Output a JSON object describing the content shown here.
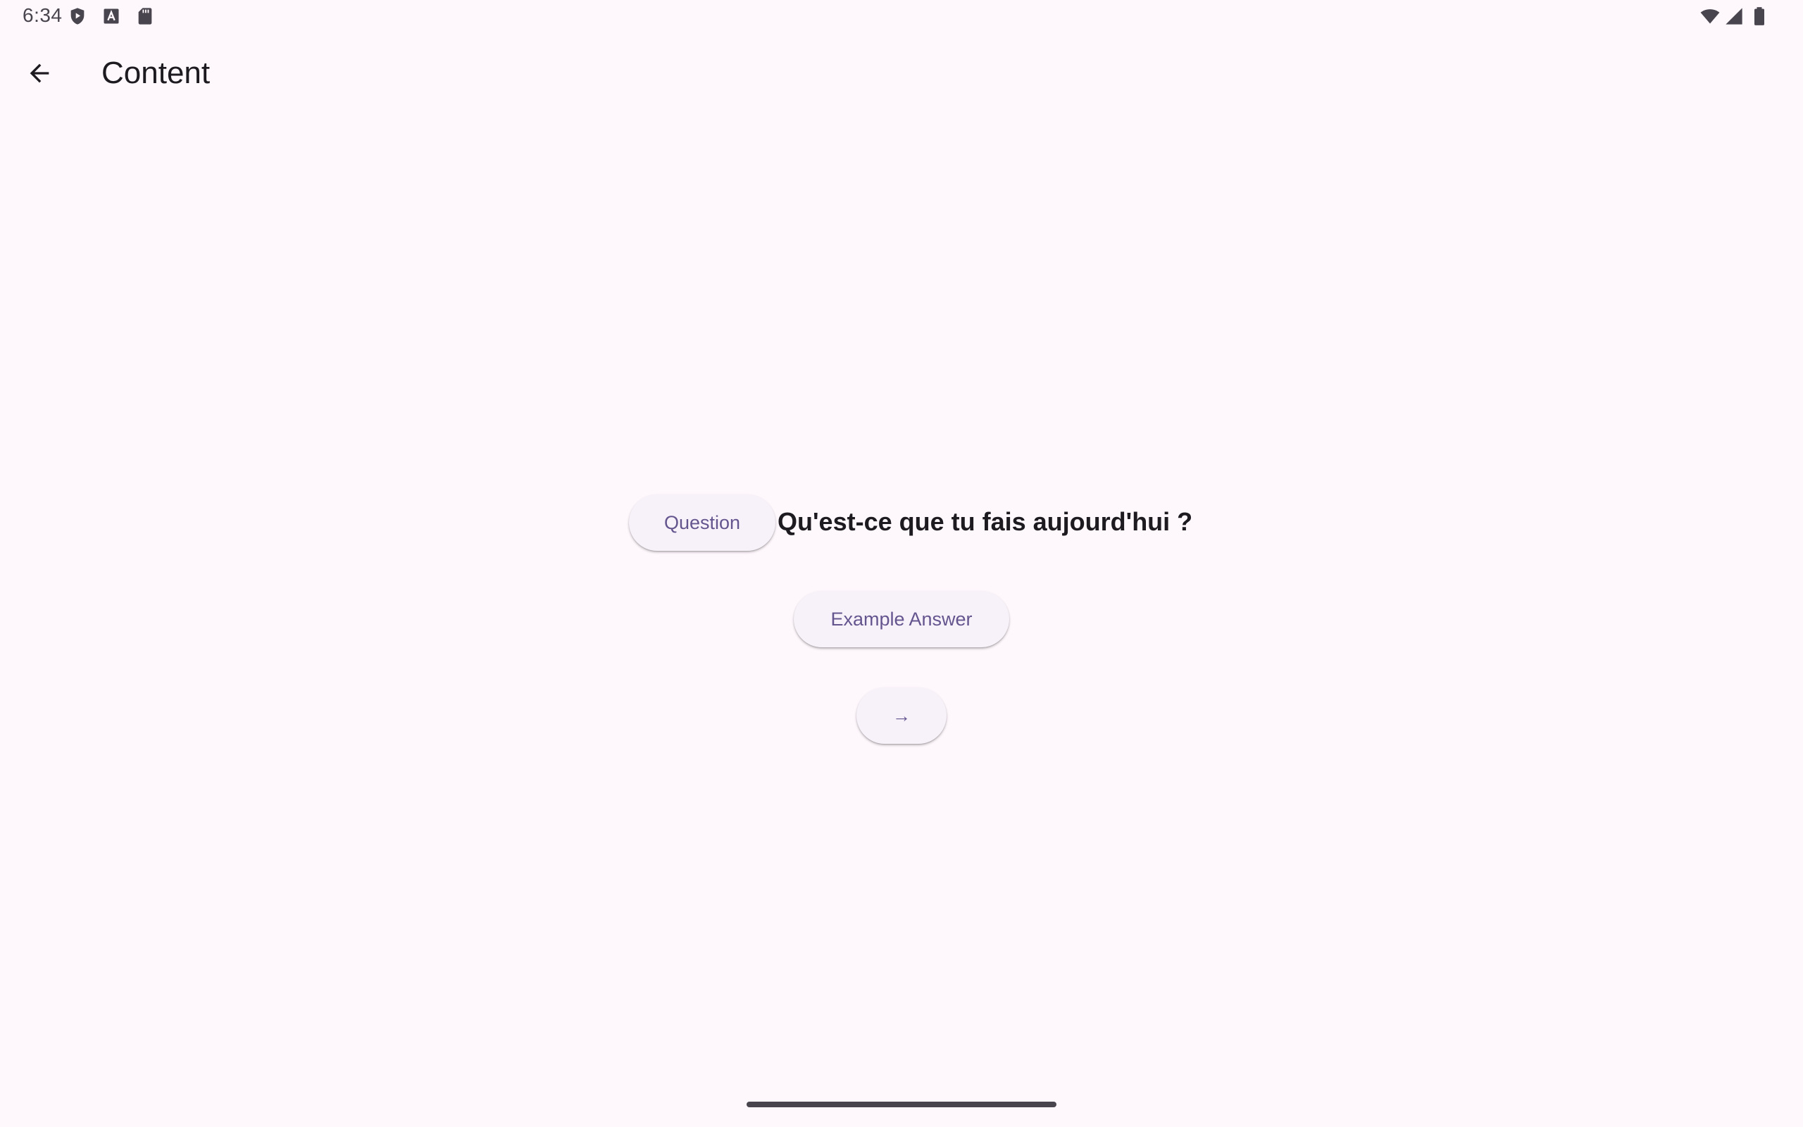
{
  "status_bar": {
    "time": "6:34",
    "left_icons": [
      "shield-play-icon",
      "font-a-icon",
      "sd-card-icon"
    ],
    "right_icons": [
      "wifi-icon",
      "cell-signal-icon",
      "battery-icon"
    ]
  },
  "app_bar": {
    "back_icon": "arrow-back-icon",
    "title": "Content"
  },
  "content": {
    "question_chip_label": "Question",
    "question_text": "Qu'est-ce que tu fais aujourd'hui ?",
    "answer_button_label": "Example Answer",
    "next_button_label": "→"
  },
  "colors": {
    "background": "#fef7fc",
    "button_surface": "#f7f2fa",
    "primary_text": "#1d1b20",
    "accent_text": "#65558f"
  }
}
